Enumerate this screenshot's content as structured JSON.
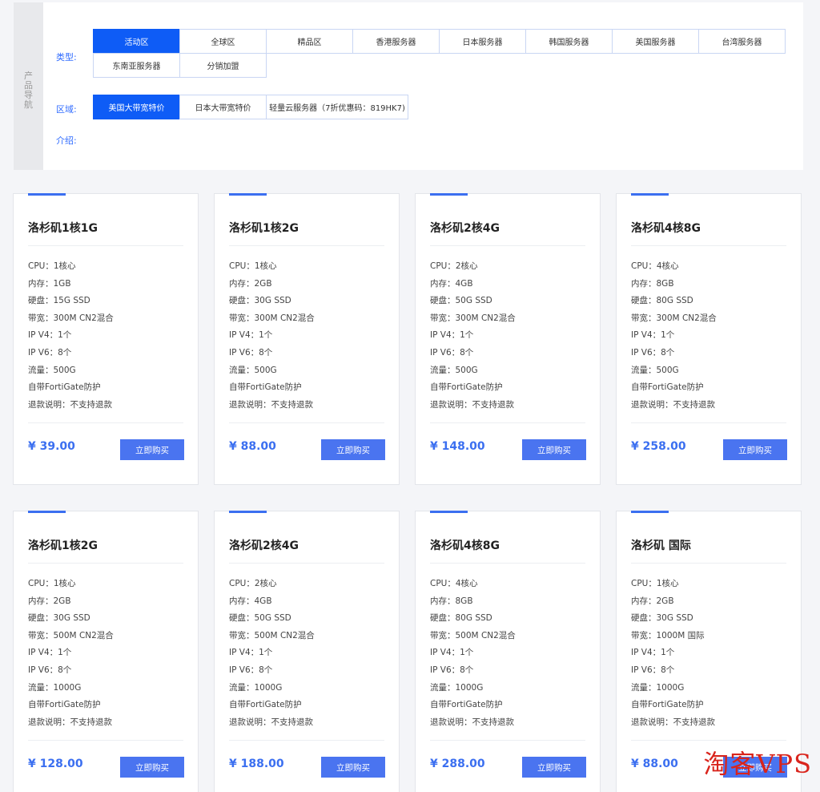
{
  "nav": {
    "side_title": [
      "产",
      "品",
      "导",
      "航"
    ],
    "type_label": "类型:",
    "types": [
      {
        "label": "活动区",
        "active": true
      },
      {
        "label": "全球区",
        "active": false
      },
      {
        "label": "精品区",
        "active": false
      },
      {
        "label": "香港服务器",
        "active": false
      },
      {
        "label": "日本服务器",
        "active": false
      },
      {
        "label": "韩国服务器",
        "active": false
      },
      {
        "label": "美国服务器",
        "active": false
      },
      {
        "label": "台湾服务器",
        "active": false
      },
      {
        "label": "东南亚服务器",
        "active": false
      },
      {
        "label": "分销加盟",
        "active": false
      }
    ],
    "region_label": "区域:",
    "regions": [
      {
        "label": "美国大带宽特价",
        "active": true
      },
      {
        "label": "日本大带宽特价",
        "active": false
      },
      {
        "label": "轻量云服务器（7折优惠码：819HK7)",
        "active": false
      }
    ],
    "intro_label": "介绍:"
  },
  "products": [
    {
      "title": "洛杉矶1核1G",
      "specs": [
        "CPU：1核心",
        "内存：1GB",
        "硬盘：15G SSD",
        "带宽：300M CN2混合",
        "IP V4：1个",
        "IP V6：8个",
        "流量：500G",
        "自带FortiGate防护",
        "退款说明：不支持退款"
      ],
      "price": "¥ 39.00",
      "buy": "立即购买"
    },
    {
      "title": "洛杉矶1核2G",
      "specs": [
        "CPU：1核心",
        "内存：2GB",
        "硬盘：30G SSD",
        "带宽：300M CN2混合",
        "IP V4：1个",
        "IP V6：8个",
        "流量：500G",
        "自带FortiGate防护",
        "退款说明：不支持退款"
      ],
      "price": "¥ 88.00",
      "buy": "立即购买"
    },
    {
      "title": "洛杉矶2核4G",
      "specs": [
        "CPU：2核心",
        "内存：4GB",
        "硬盘：50G SSD",
        "带宽：300M CN2混合",
        "IP V4：1个",
        "IP V6：8个",
        "流量：500G",
        "自带FortiGate防护",
        "退款说明：不支持退款"
      ],
      "price": "¥ 148.00",
      "buy": "立即购买"
    },
    {
      "title": "洛杉矶4核8G",
      "specs": [
        "CPU：4核心",
        "内存：8GB",
        "硬盘：80G SSD",
        "带宽：300M CN2混合",
        "IP V4：1个",
        "IP V6：8个",
        "流量：500G",
        "自带FortiGate防护",
        "退款说明：不支持退款"
      ],
      "price": "¥ 258.00",
      "buy": "立即购买"
    },
    {
      "title": "洛杉矶1核2G",
      "specs": [
        "CPU：1核心",
        "内存：2GB",
        "硬盘：30G SSD",
        "带宽：500M CN2混合",
        "IP V4：1个",
        "IP V6：8个",
        "流量：1000G",
        "自带FortiGate防护",
        "退款说明：不支持退款"
      ],
      "price": "¥ 128.00",
      "buy": "立即购买"
    },
    {
      "title": "洛杉矶2核4G",
      "specs": [
        "CPU：2核心",
        "内存：4GB",
        "硬盘：50G SSD",
        "带宽：500M CN2混合",
        "IP V4：1个",
        "IP V6：8个",
        "流量：1000G",
        "自带FortiGate防护",
        "退款说明：不支持退款"
      ],
      "price": "¥ 188.00",
      "buy": "立即购买"
    },
    {
      "title": "洛杉矶4核8G",
      "specs": [
        "CPU：4核心",
        "内存：8GB",
        "硬盘：80G SSD",
        "带宽：500M CN2混合",
        "IP V4：1个",
        "IP V6：8个",
        "流量：1000G",
        "自带FortiGate防护",
        "退款说明：不支持退款"
      ],
      "price": "¥ 288.00",
      "buy": "立即购买"
    },
    {
      "title": "洛杉矶 国际",
      "specs": [
        "CPU：1核心",
        "内存：2GB",
        "硬盘：30G SSD",
        "带宽：1000M 国际",
        "IP V4：1个",
        "IP V6：8个",
        "流量：1000G",
        "自带FortiGate防护",
        "退款说明：不支持退款"
      ],
      "price": "¥ 88.00",
      "buy": "立即购买"
    }
  ],
  "watermark": "淘客VPS"
}
